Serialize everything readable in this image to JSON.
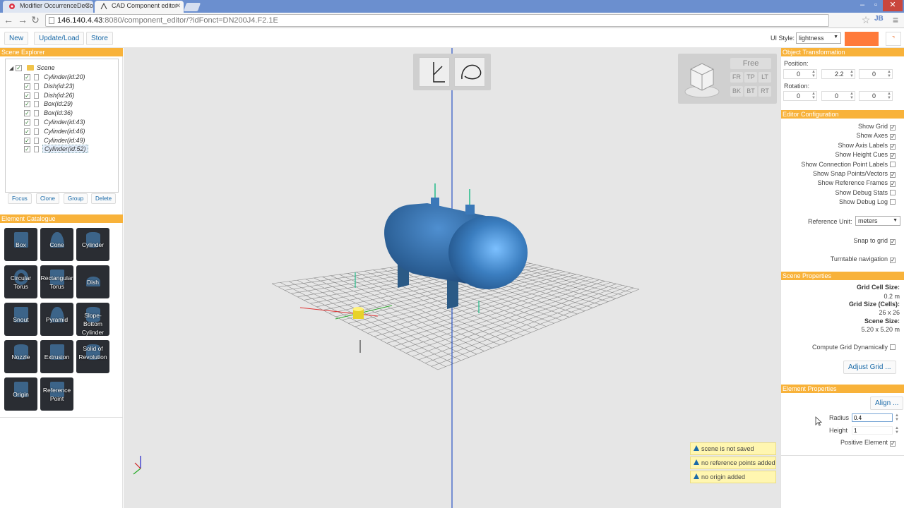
{
  "browser": {
    "tabs": [
      {
        "title": "Modifier OccurrenceDeCo",
        "icon": "gear-red-icon"
      },
      {
        "title": "CAD Component editor",
        "icon": "cad-icon"
      }
    ],
    "url_host": "146.140.4.43",
    "url_path": ":8080/component_editor/?idFonct=DN200J4.F2.1E",
    "profile_badge": "JB"
  },
  "toolbar": {
    "new_label": "New",
    "update_label": "Update/Load",
    "store_label": "Store",
    "ui_style_label": "UI Style:",
    "ui_style_value": "lightness",
    "accent_color": "#ff7a3a"
  },
  "scene_explorer": {
    "title": "Scene Explorer",
    "root": "Scene",
    "items": [
      "Cylinder(id:20)",
      "Dish(id:23)",
      "Dish(id:26)",
      "Box(id:29)",
      "Box(id:36)",
      "Cylinder(id:43)",
      "Cylinder(id:46)",
      "Cylinder(id:49)",
      "Cylinder(id:52)"
    ],
    "selected_index": 8,
    "actions": {
      "focus": "Focus",
      "clone": "Clone",
      "group": "Group",
      "delete": "Delete"
    }
  },
  "element_catalogue": {
    "title": "Element Catalogue",
    "items": [
      "Box",
      "Cone",
      "Cylinder",
      "Circular Torus",
      "Rectangular Torus",
      "Dish",
      "Snout",
      "Pyramid",
      "Slope-Bottom Cylinder",
      "Nozzle",
      "Extrusion",
      "Solid of Revolution",
      "Origin",
      "Reference Point"
    ]
  },
  "viewport": {
    "camera_mode": "Free",
    "camera_buttons": [
      "FR",
      "TP",
      "LT",
      "BK",
      "BT",
      "RT"
    ],
    "warnings": [
      "scene is not saved",
      "no reference points added",
      "no origin added"
    ]
  },
  "object_transformation": {
    "title": "Object Transformation",
    "position_label": "Position:",
    "position": [
      "0",
      "2.2",
      "0"
    ],
    "rotation_label": "Rotation:",
    "rotation": [
      "0",
      "0",
      "0"
    ]
  },
  "editor_configuration": {
    "title": "Editor Configuration",
    "options": [
      {
        "label": "Show Grid",
        "checked": true
      },
      {
        "label": "Show Axes",
        "checked": true
      },
      {
        "label": "Show Axis Labels",
        "checked": true
      },
      {
        "label": "Show Height Cues",
        "checked": true
      },
      {
        "label": "Show Connection Point Labels",
        "checked": false
      },
      {
        "label": "Show Snap Points/Vectors",
        "checked": true
      },
      {
        "label": "Show Reference Frames",
        "checked": true
      },
      {
        "label": "Show Debug Stats",
        "checked": false
      },
      {
        "label": "Show Debug Log",
        "checked": false
      }
    ],
    "reference_unit_label": "Reference Unit:",
    "reference_unit_value": "meters",
    "snap_to_grid_label": "Snap to grid",
    "snap_to_grid": true,
    "turntable_label": "Turntable navigation",
    "turntable": true
  },
  "scene_properties": {
    "title": "Scene Properties",
    "grid_cell_size_label": "Grid Cell Size:",
    "grid_cell_size": "0.2 m",
    "grid_size_label": "Grid Size (Cells):",
    "grid_size": "26 x 26",
    "scene_size_label": "Scene Size:",
    "scene_size": "5.20 x 5.20 m",
    "compute_grid_label": "Compute Grid Dynamically",
    "compute_grid": false,
    "adjust_grid_label": "Adjust Grid ..."
  },
  "element_properties": {
    "title": "Element Properties",
    "align_label": "Align ...",
    "radius_label": "Radius",
    "radius_value": "0.4",
    "height_label": "Height",
    "height_value": "1",
    "positive_label": "Positive Element",
    "positive": true
  }
}
